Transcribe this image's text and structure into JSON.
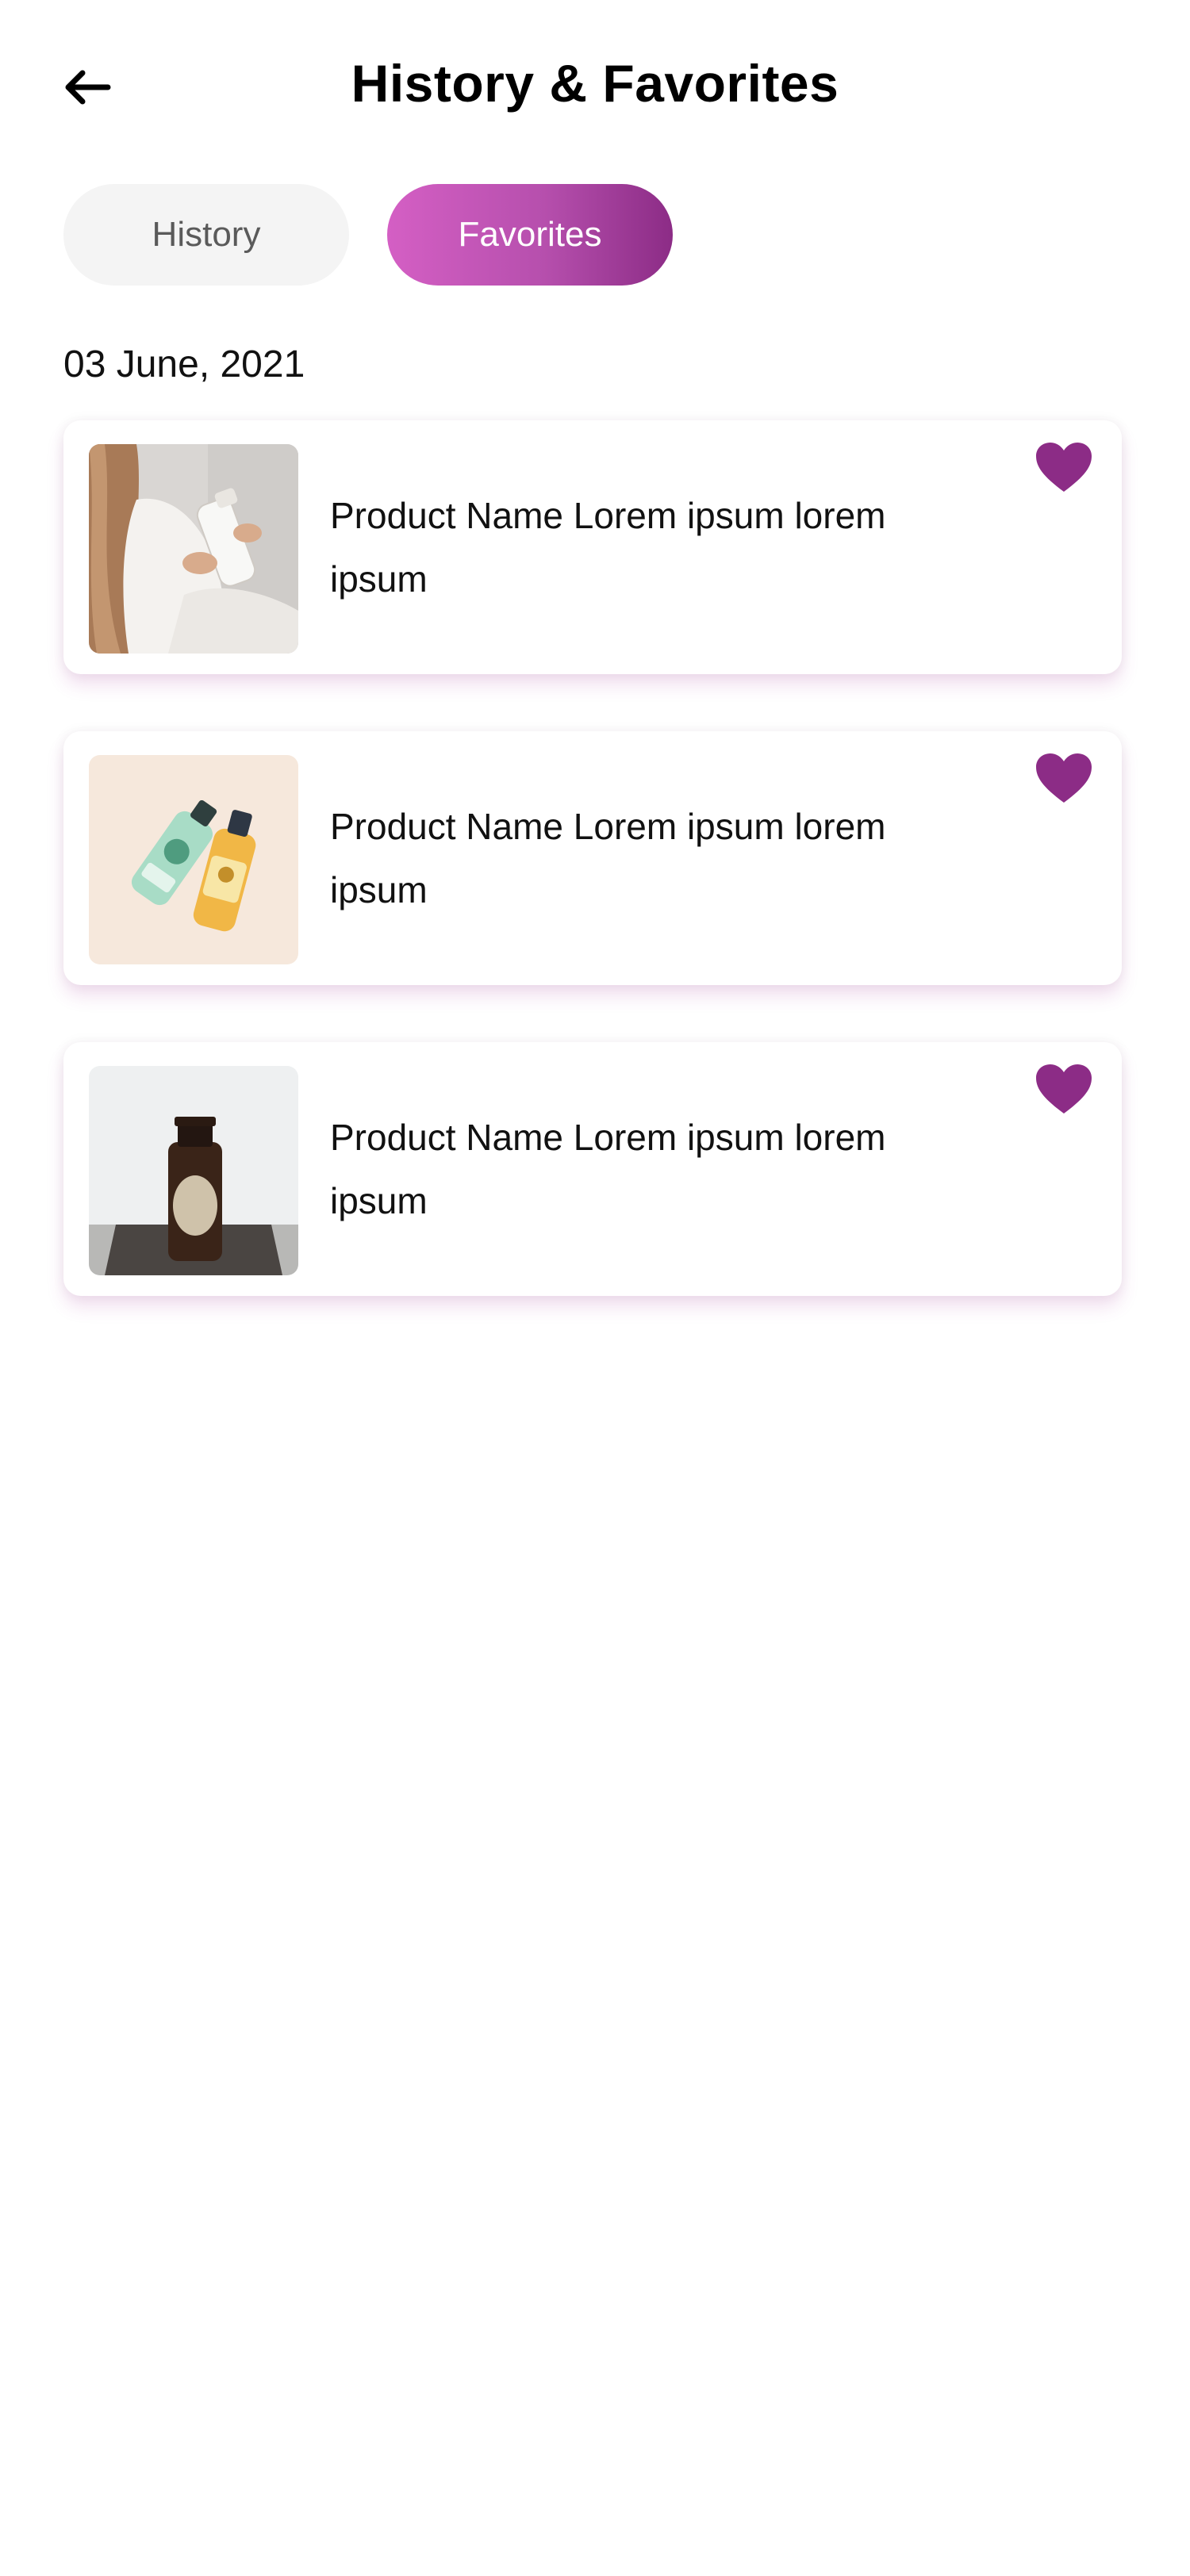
{
  "header": {
    "title": "History & Favorites",
    "back_icon": "arrow-left-icon"
  },
  "tabs": [
    {
      "label": "History",
      "active": false
    },
    {
      "label": "Favorites",
      "active": true
    }
  ],
  "section": {
    "date": "03 June, 2021"
  },
  "favorites": [
    {
      "name": "Product Name Lorem ipsum lorem ipsum",
      "image": "woman-holding-lotion-bottle",
      "favorite": true
    },
    {
      "name": "Product Name Lorem ipsum lorem ipsum",
      "image": "two-shower-gel-bottles",
      "favorite": true
    },
    {
      "name": "Product Name Lorem ipsum lorem ipsum",
      "image": "amber-glass-bottle",
      "favorite": true
    }
  ],
  "colors": {
    "accent": "#8c2c86",
    "gradient_start": "#d45fc4",
    "gradient_end": "#8c2c86",
    "tab_inactive_bg": "#f4f4f4"
  }
}
